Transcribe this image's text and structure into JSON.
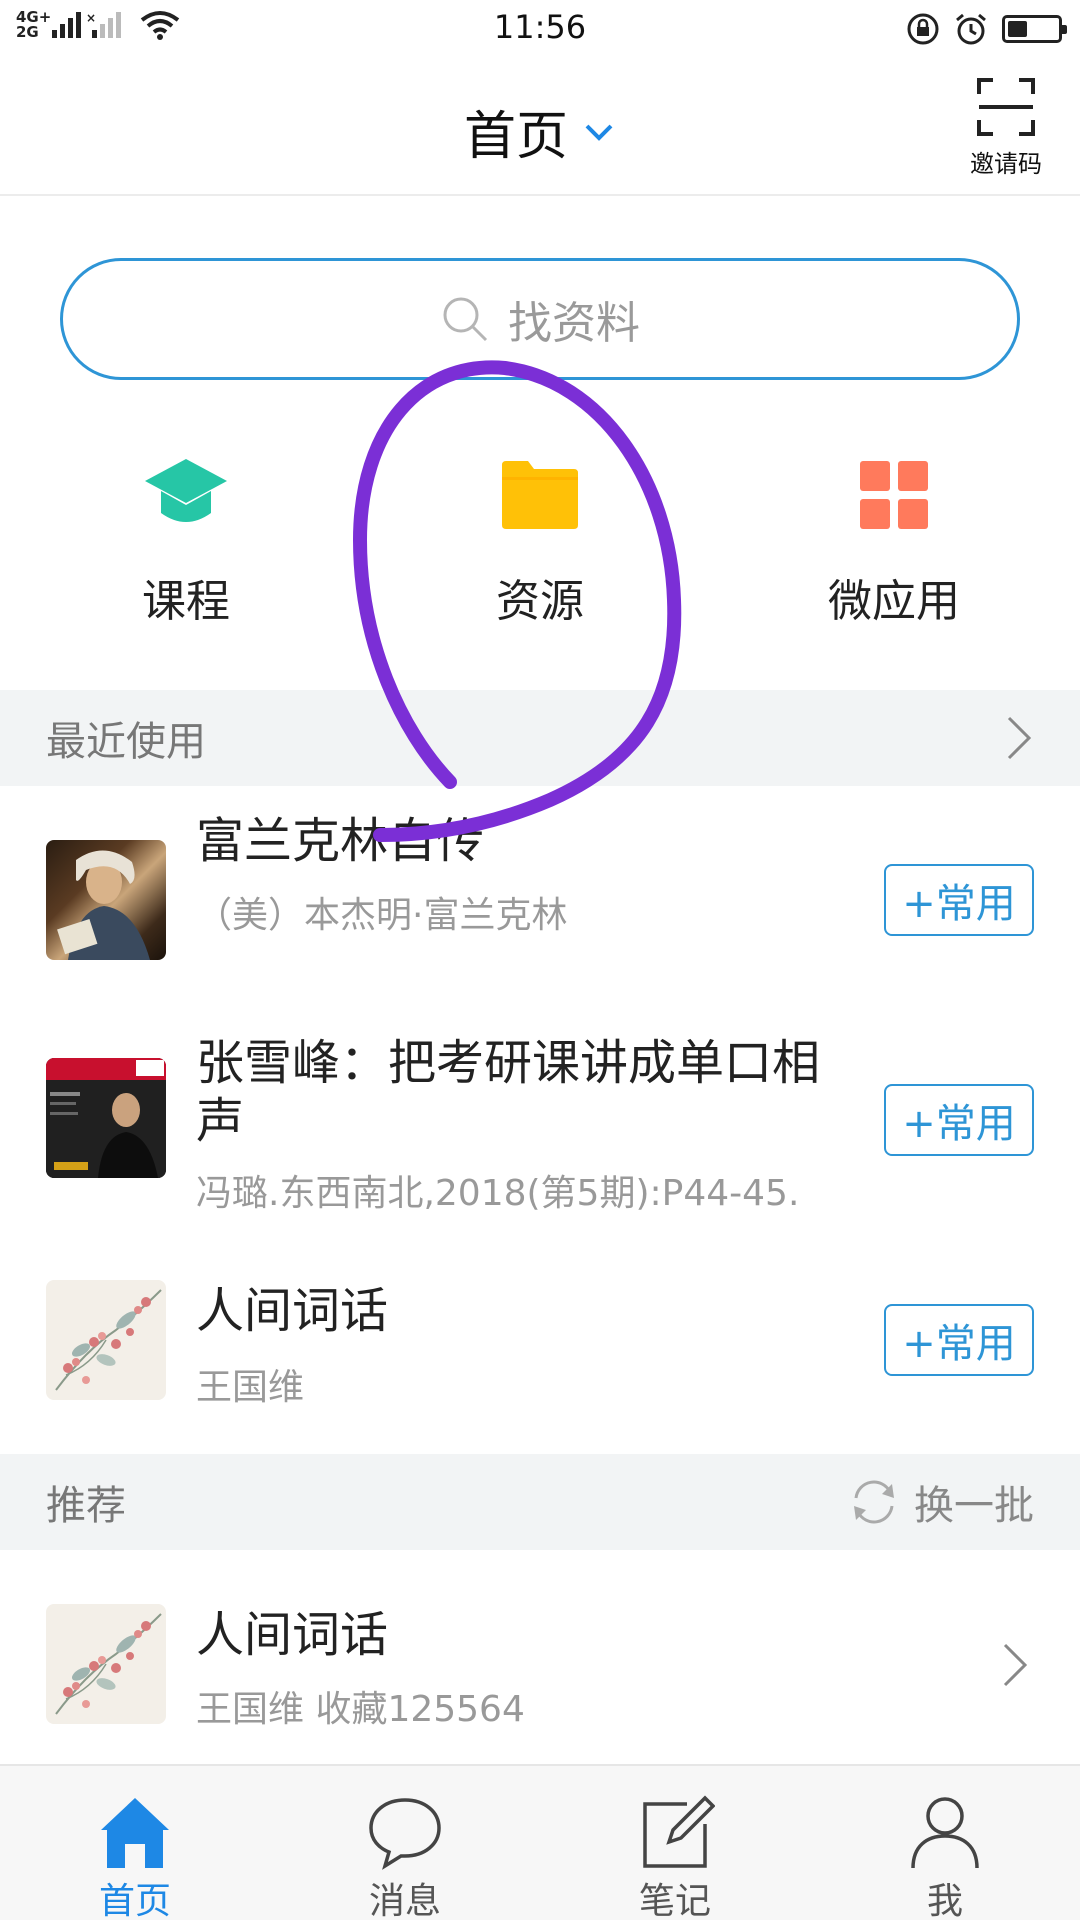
{
  "status_bar": {
    "network_top": "4G+",
    "network_bottom": "2G",
    "time": "11:56",
    "battery_level": 0.4
  },
  "header": {
    "title": "首页",
    "invite_label": "邀请码"
  },
  "search": {
    "placeholder": "找资料"
  },
  "quick_actions": [
    {
      "label": "课程",
      "icon": "graduation-cap-icon",
      "color": "#26c6a6"
    },
    {
      "label": "资源",
      "icon": "folder-icon",
      "color": "#ffc107"
    },
    {
      "label": "微应用",
      "icon": "app-grid-icon",
      "color": "#ff7a5c"
    }
  ],
  "recent": {
    "title": "最近使用",
    "items": [
      {
        "title": "富兰克林自传",
        "subtitle": "（美）本杰明·富兰克林",
        "button": "+常用"
      },
      {
        "title": "张雪峰：把考研课讲成单口相声",
        "subtitle": "冯璐.东西南北,2018(第5期):P44-45.",
        "button": "+常用"
      },
      {
        "title": "人间词话",
        "subtitle": "王国维",
        "button": "+常用"
      }
    ]
  },
  "recommend": {
    "title": "推荐",
    "refresh_label": "换一批",
    "items": [
      {
        "title": "人间词话",
        "subtitle": "王国维  收藏125564"
      }
    ]
  },
  "bottom_nav": [
    {
      "label": "首页",
      "icon": "home-icon",
      "active": true
    },
    {
      "label": "消息",
      "icon": "chat-bubble-icon",
      "active": false
    },
    {
      "label": "笔记",
      "icon": "edit-note-icon",
      "active": false
    },
    {
      "label": "我",
      "icon": "person-icon",
      "active": false
    }
  ],
  "colors": {
    "accent": "#2e95d6",
    "nav_active": "#1e88e5",
    "annotation": "#7b2fd6"
  }
}
